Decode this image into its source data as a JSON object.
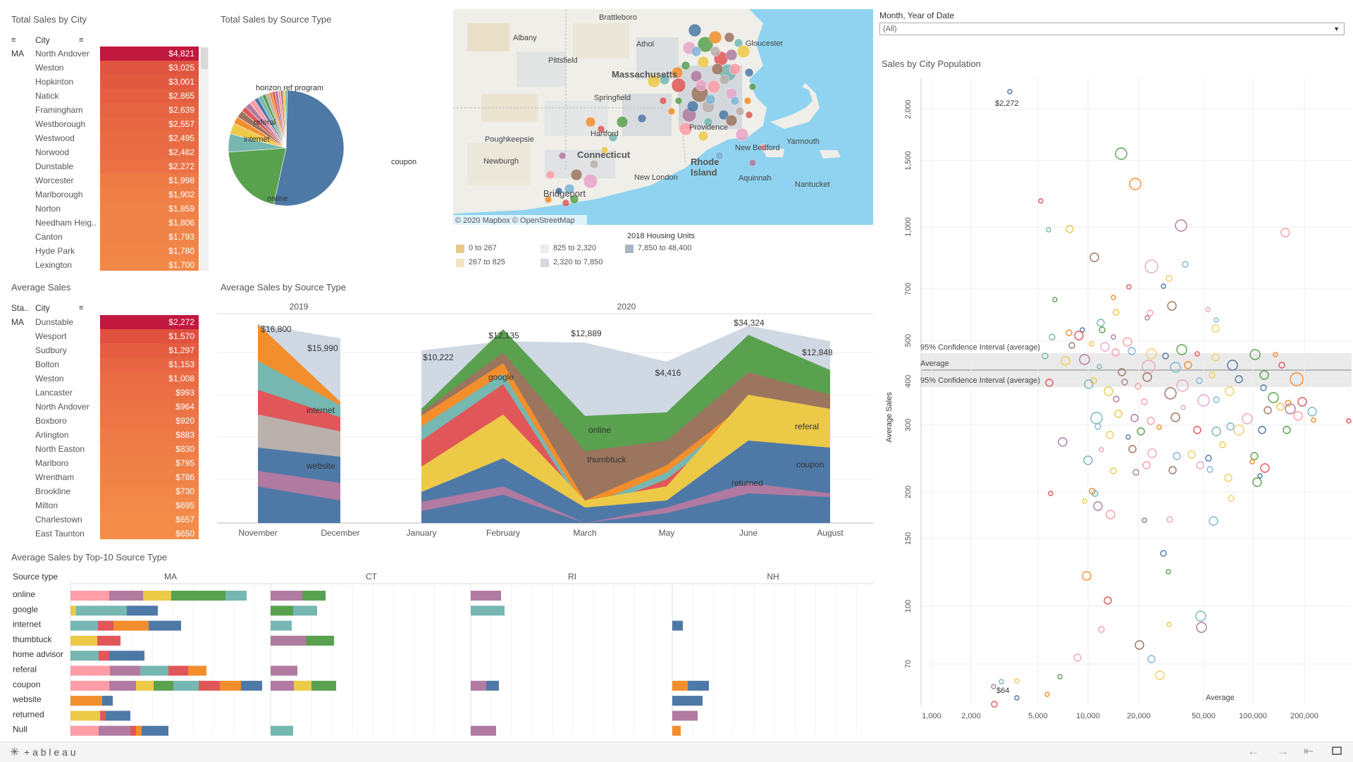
{
  "colors": {
    "blue": "#4e79a7",
    "green": "#59a14f",
    "orange": "#f28e2b",
    "red": "#e15759",
    "teal": "#76b7b2",
    "yellow": "#edc948",
    "purple": "#b07aa1",
    "pink": "#ff9da7",
    "brown": "#9c755f",
    "gray": "#bab0ac",
    "bgArea": "#d0d8e4"
  },
  "total_sales_by_city": {
    "title": "Total Sales by City",
    "col_city": "City",
    "state": "MA",
    "rows": [
      {
        "city": "North Andover",
        "value": "$4,821",
        "color": "#c0183e"
      },
      {
        "city": "Weston",
        "value": "$3,025",
        "color": "#e0553f"
      },
      {
        "city": "Hopkinton",
        "value": "$3,001",
        "color": "#e15a40"
      },
      {
        "city": "Natick",
        "value": "$2,865",
        "color": "#e35f40"
      },
      {
        "city": "Framingham",
        "value": "$2,639",
        "color": "#e66442"
      },
      {
        "city": "Westborough",
        "value": "$2,557",
        "color": "#e76843"
      },
      {
        "city": "Westwood",
        "value": "$2,495",
        "color": "#e86b44"
      },
      {
        "city": "Norwood",
        "value": "$2,482",
        "color": "#e96c44"
      },
      {
        "city": "Dunstable",
        "value": "$2,272",
        "color": "#eb7145"
      },
      {
        "city": "Worcester",
        "value": "$1,998",
        "color": "#ee7b46"
      },
      {
        "city": "Marlborough",
        "value": "$1,902",
        "color": "#ef7f47"
      },
      {
        "city": "Norton",
        "value": "$1,859",
        "color": "#f08148"
      },
      {
        "city": "Needham Heig..",
        "value": "$1,806",
        "color": "#f08348"
      },
      {
        "city": "Canton",
        "value": "$1,793",
        "color": "#f08448"
      },
      {
        "city": "Hyde Park",
        "value": "$1,780",
        "color": "#f18548"
      },
      {
        "city": "Lexington",
        "value": "$1,700",
        "color": "#f28848"
      }
    ]
  },
  "average_sales_table": {
    "title": "Average Sales",
    "col_state": "Sta..",
    "col_city": "City",
    "state": "MA",
    "rows": [
      {
        "city": "Dunstable",
        "value": "$2,272",
        "color": "#c0183e"
      },
      {
        "city": "Wesport",
        "value": "$1,570",
        "color": "#e0503e"
      },
      {
        "city": "Sudbury",
        "value": "$1,297",
        "color": "#e45d40"
      },
      {
        "city": "Bolton",
        "value": "$1,153",
        "color": "#e76543"
      },
      {
        "city": "Weston",
        "value": "$1,008",
        "color": "#e96c44"
      },
      {
        "city": "Lancaster",
        "value": "$993",
        "color": "#ea6f45"
      },
      {
        "city": "North Andover",
        "value": "$964",
        "color": "#eb7245"
      },
      {
        "city": "Boxboro",
        "value": "$920",
        "color": "#ec7646"
      },
      {
        "city": "Arlington",
        "value": "$883",
        "color": "#ed7947"
      },
      {
        "city": "North Easton",
        "value": "$830",
        "color": "#ee7d47"
      },
      {
        "city": "Marlboro",
        "value": "$795",
        "color": "#ef8048"
      },
      {
        "city": "Wrentham",
        "value": "$786",
        "color": "#f08248"
      },
      {
        "city": "Brookline",
        "value": "$730",
        "color": "#f18648"
      },
      {
        "city": "Milton",
        "value": "$695",
        "color": "#f28949"
      },
      {
        "city": "Charlestown",
        "value": "$657",
        "color": "#f38c49"
      },
      {
        "city": "East Taunton",
        "value": "$650",
        "color": "#f38d49"
      }
    ]
  },
  "pie": {
    "title": "Total Sales by Source Type",
    "labels": {
      "coupon": "coupon",
      "online": "online",
      "internet": "internet",
      "referal": "referal",
      "horizon": "horizon ref program"
    }
  },
  "map": {
    "places": [
      {
        "name": "Brattleboro"
      },
      {
        "name": "Albany"
      },
      {
        "name": "Athol"
      },
      {
        "name": "Gloucester"
      },
      {
        "name": "Pittsfield"
      },
      {
        "name": "Massachusetts"
      },
      {
        "name": "Springfield"
      },
      {
        "name": "Poughkeepsie"
      },
      {
        "name": "Hartford"
      },
      {
        "name": "Providence"
      },
      {
        "name": "Yarmouth"
      },
      {
        "name": "Connecticut"
      },
      {
        "name": "Newburgh"
      },
      {
        "name": "New Bedford"
      },
      {
        "name": "Rhode"
      },
      {
        "name": "Island"
      },
      {
        "name": "New London"
      },
      {
        "name": "Aquinnah"
      },
      {
        "name": "Nantucket"
      },
      {
        "name": "Bridgeport"
      }
    ],
    "credit": "© 2020 Mapbox  © OpenStreetMap",
    "legend_title": "2018 Housing Units",
    "legend": [
      {
        "label": "0 to 267",
        "color": "#e8c98a"
      },
      {
        "label": "267 to 825",
        "color": "#f2e2c0"
      },
      {
        "label": "825 to 2,320",
        "color": "#ececec"
      },
      {
        "label": "2,320 to 7,850",
        "color": "#d4d9df"
      },
      {
        "label": "7,850 to 48,400",
        "color": "#a9b5c4"
      }
    ]
  },
  "filter": {
    "label": "Month, Year of Date",
    "value": "(All)"
  },
  "area": {
    "title": "Average Sales by Source Type",
    "years": [
      "2019",
      "2020"
    ],
    "months": [
      "November",
      "December",
      "January",
      "February",
      "March",
      "May",
      "June",
      "August"
    ],
    "totals": [
      "$16,800",
      "$15,990",
      "$10,222",
      "$12,135",
      "$12,889",
      "$4,416",
      "$34,324",
      "$12,848"
    ],
    "labels": {
      "internet": "internet",
      "website": "website",
      "google": "google",
      "online": "online",
      "thumbtuck": "thumbtuck",
      "returned": "returned",
      "referal": "referal",
      "coupon": "coupon"
    }
  },
  "scatter": {
    "title": "Sales by City Population",
    "ylabel": "Average Sales",
    "yticks": [
      "2,000",
      "1,500",
      "1,000",
      "700",
      "500",
      "400",
      "300",
      "200",
      "150",
      "100",
      "70"
    ],
    "xticks": [
      "1,000",
      "2,000",
      "5,000",
      "10,000",
      "20,000",
      "50,000",
      "100,000",
      "200,000"
    ],
    "max_label": "$2,272",
    "min_label": "$64",
    "avg_label": "Average",
    "ci_label": "95% Confidence Interval (average)",
    "x_avg_label": "Average"
  },
  "bars": {
    "title": "Average Sales by Top-10 Source Type",
    "col": "Source type",
    "states": [
      "MA",
      "CT",
      "RI",
      "NH"
    ],
    "types": [
      "online",
      "google",
      "internet",
      "thumbtuck",
      "home advisor",
      "referal",
      "coupon",
      "website",
      "returned",
      "Null"
    ]
  },
  "footer": {
    "brand": "+ a b l e a u"
  }
}
